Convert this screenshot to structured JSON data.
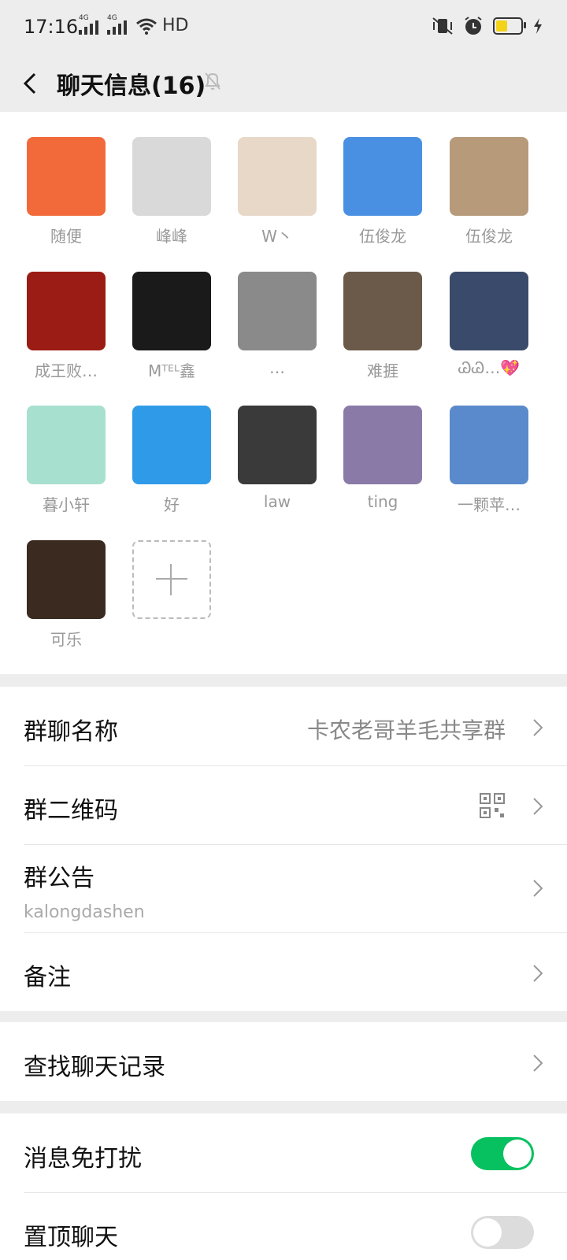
{
  "status_bar": {
    "time": "17:16",
    "network_1": "4G",
    "network_2": "4G",
    "hd": "HD",
    "battery_level": 0.45
  },
  "header": {
    "title": "聊天信息(16)"
  },
  "members": [
    {
      "name": "随便",
      "color": "#f26a3a"
    },
    {
      "name": "峰峰",
      "color": "#d9d9d9"
    },
    {
      "name": "W丶",
      "color": "#e8d8c8"
    },
    {
      "name": "伍俊龙",
      "color": "#4a90e2"
    },
    {
      "name": "伍俊龙",
      "color": "#b79a7a"
    },
    {
      "name": "成王败…",
      "color": "#9b1c14"
    },
    {
      "name": "Mᵀᴱᴸ鑫",
      "color": "#1a1a1a"
    },
    {
      "name": "…",
      "color": "#8a8a8a"
    },
    {
      "name": "难捱",
      "color": "#6b5a4a"
    },
    {
      "name": "ᏊᏊ…💖",
      "color": "#3a4a6a"
    },
    {
      "name": "暮小轩",
      "color": "#a8e0d0"
    },
    {
      "name": "好",
      "color": "#2f9be8"
    },
    {
      "name": "law",
      "color": "#3a3a3a"
    },
    {
      "name": "ting",
      "color": "#8a7aa8"
    },
    {
      "name": "一颗苹…",
      "color": "#5a8acb"
    },
    {
      "name": "可乐",
      "color": "#3a2a20"
    }
  ],
  "rows": {
    "group_name": {
      "label": "群聊名称",
      "value": "卡农老哥羊毛共享群"
    },
    "group_qr": {
      "label": "群二维码"
    },
    "announcement": {
      "label": "群公告",
      "value": "kalongdashen"
    },
    "remark": {
      "label": "备注"
    },
    "search_history": {
      "label": "查找聊天记录"
    },
    "mute": {
      "label": "消息免打扰",
      "on": true
    },
    "pin": {
      "label": "置顶聊天",
      "on": false
    }
  },
  "colors": {
    "accent": "#07c160",
    "background": "#ededed"
  }
}
